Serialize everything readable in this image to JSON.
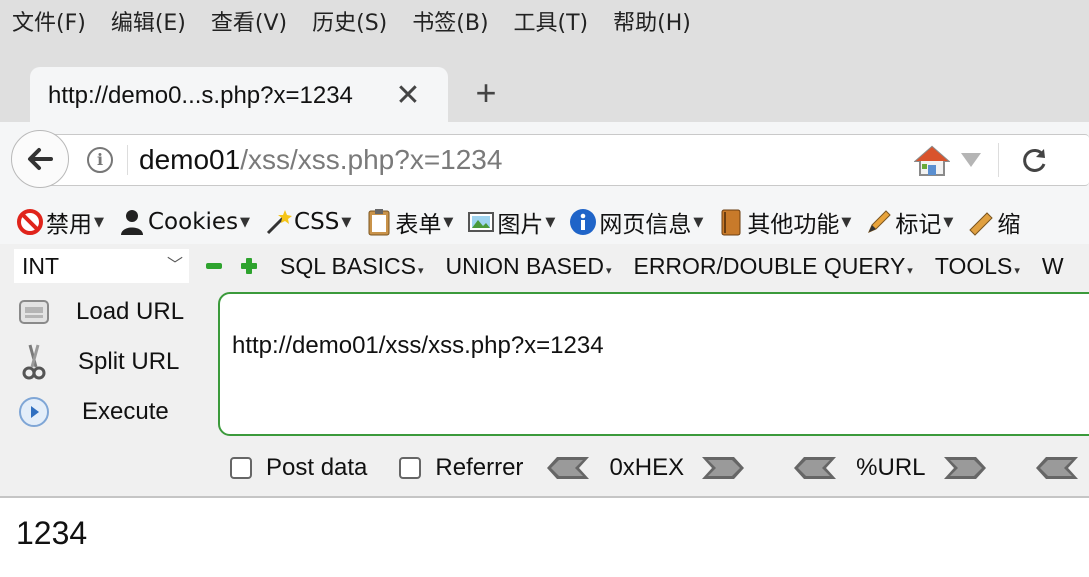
{
  "menubar": {
    "items": [
      "文件(F)",
      "编辑(E)",
      "查看(V)",
      "历史(S)",
      "书签(B)",
      "工具(T)",
      "帮助(H)"
    ]
  },
  "tab": {
    "title": "http://demo0...s.php?x=1234",
    "close_icon": "close-icon",
    "new_tab_icon": "plus-icon"
  },
  "navbar": {
    "url_host": "demo01",
    "url_path": "/xss/xss.php?x=1234",
    "icons": [
      "back-arrow-icon",
      "info-icon",
      "home-icon",
      "dropdown-arrow-icon",
      "reload-icon"
    ]
  },
  "addon_toolbar": {
    "items": [
      {
        "label": "禁用",
        "icon": "disable-icon"
      },
      {
        "label": "Cookies",
        "icon": "person-icon"
      },
      {
        "label": "CSS",
        "icon": "magic-wand-icon"
      },
      {
        "label": "表单",
        "icon": "clipboard-icon"
      },
      {
        "label": "图片",
        "icon": "image-icon"
      },
      {
        "label": "网页信息",
        "icon": "info-circle-icon"
      },
      {
        "label": "其他功能",
        "icon": "book-icon"
      },
      {
        "label": "标记",
        "icon": "pencil-icon"
      },
      {
        "label": "缩",
        "icon": "ruler-icon"
      }
    ]
  },
  "hackbar": {
    "select_value": "INT",
    "menu": [
      "SQL BASICS",
      "UNION BASED",
      "ERROR/DOUBLE QUERY",
      "TOOLS",
      "W"
    ],
    "actions": {
      "load": "Load URL",
      "split": "Split URL",
      "execute": "Execute"
    },
    "textarea_value": "http://demo01/xss/xss.php?x=1234",
    "post_data_label": "Post data",
    "referrer_label": "Referrer",
    "hex_label": "0xHEX",
    "url_label": "%URL",
    "post_data_checked": false,
    "referrer_checked": false,
    "accent_green": "#3b9a3b"
  },
  "page": {
    "output": "1234"
  }
}
